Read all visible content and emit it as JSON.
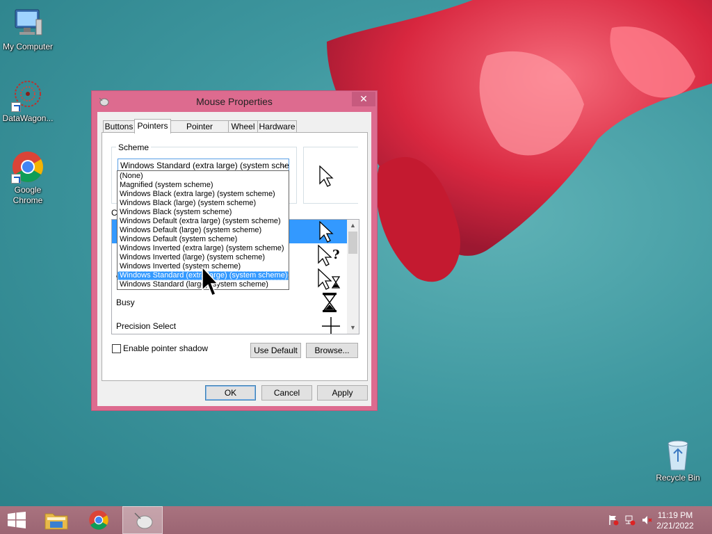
{
  "desktop": {
    "icons": [
      {
        "label": "My Computer"
      },
      {
        "label": "DataWagon..."
      },
      {
        "label": "Google Chrome"
      },
      {
        "label": "Recycle Bin"
      }
    ]
  },
  "dialog": {
    "title": "Mouse Properties",
    "close_glyph": "✕",
    "tabs": [
      "Buttons",
      "Pointers",
      "Pointer Options",
      "Wheel",
      "Hardware"
    ],
    "active_tab": "Pointers",
    "scheme_group_label": "Scheme",
    "scheme_selected": "Windows Standard (extra large) (system scheme)",
    "customize_label": "Cu",
    "cursor_rows": [
      {
        "label": ""
      },
      {
        "label": "H"
      },
      {
        "label": "W"
      },
      {
        "label": "Busy"
      },
      {
        "label": "Precision Select"
      }
    ],
    "pointer_shadow_label": "Enable pointer shadow",
    "pointer_shadow_checked": false,
    "use_default_label": "Use Default",
    "browse_label": "Browse...",
    "ok_label": "OK",
    "cancel_label": "Cancel",
    "apply_label": "Apply",
    "dropdown_items": [
      "(None)",
      "Magnified (system scheme)",
      "Windows Black (extra large) (system scheme)",
      "Windows Black (large) (system scheme)",
      "Windows Black (system scheme)",
      "Windows Default (extra large) (system scheme)",
      "Windows Default (large) (system scheme)",
      "Windows Default (system scheme)",
      "Windows Inverted (extra large) (system scheme)",
      "Windows Inverted (large) (system scheme)",
      "Windows Inverted (system scheme)",
      "Windows Standard (extra large) (system scheme)",
      "Windows Standard (large) (system scheme)"
    ],
    "dropdown_highlighted_index": 11
  },
  "taskbar": {
    "time": "11:19 PM",
    "date": "2/21/2022"
  },
  "colors": {
    "window_frame": "#dd6b8f",
    "selection": "#3399ff",
    "desktop": "#3f98a0"
  }
}
